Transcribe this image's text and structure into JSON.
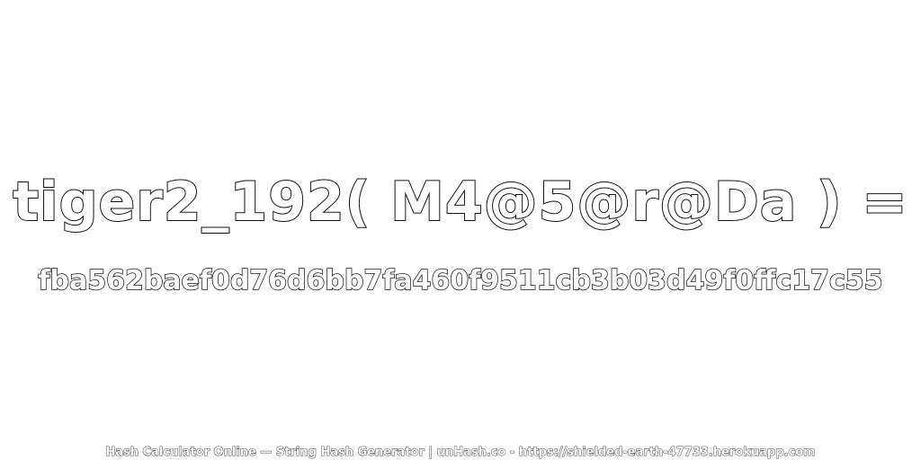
{
  "title": "tiger2_192( M4@5@r@Da ) =",
  "hash": "fba562baef0d76d6bb7fa460f9511cb3b03d49f0ffc17c55",
  "footer": "Hash Calculator Online — String Hash Generator | unHash.co - https://shielded-earth-47733.herokuapp.com",
  "colors": {
    "background": "#ffffff",
    "text_fill": "#ffffff",
    "text_outline": "#111111"
  }
}
